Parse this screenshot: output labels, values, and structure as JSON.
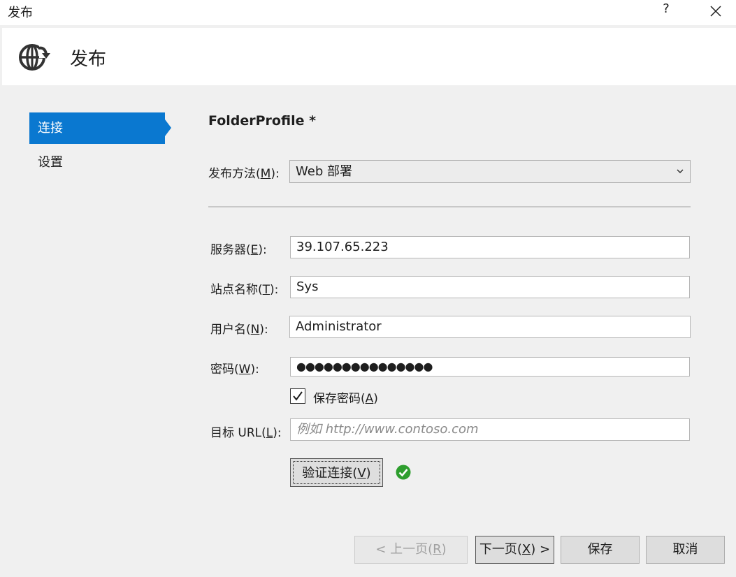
{
  "window": {
    "title": "发布",
    "help_label": "?"
  },
  "header": {
    "heading": "发布"
  },
  "sidebar": {
    "items": [
      {
        "label": "连接",
        "selected": true
      },
      {
        "label": "设置",
        "selected": false
      }
    ],
    "accent": "#0a78d0"
  },
  "content": {
    "profile_title": "FolderProfile *",
    "publish_method": {
      "label": "发布方法(",
      "mnemonic": "M",
      "label_end": "):",
      "value": "Web 部署"
    },
    "server": {
      "label": "服务器(",
      "mnemonic": "E",
      "label_end": "):",
      "value": "39.107.65.223"
    },
    "site_name": {
      "label": "站点名称(",
      "mnemonic": "T",
      "label_end": "):",
      "value": "Sys"
    },
    "username": {
      "label": "用户名(",
      "mnemonic": "N",
      "label_end": "):",
      "value": "Administrator"
    },
    "password": {
      "label": "密码(",
      "mnemonic": "W",
      "label_end": "):",
      "value": "●●●●●●●●●●●●●●●"
    },
    "save_password": {
      "label": "保存密码(",
      "mnemonic": "A",
      "label_end": ")",
      "checked": true
    },
    "target_url": {
      "label": "目标 URL(",
      "mnemonic": "L",
      "label_end": "):",
      "value": "",
      "placeholder": "例如 http://www.contoso.com"
    },
    "validate": {
      "label": "验证连接(",
      "mnemonic": "V",
      "label_end": ")",
      "status": "success",
      "status_color": "#2e9e2e"
    }
  },
  "footer": {
    "prev_label": "< 上一页(",
    "prev_mnemonic": "R",
    "prev_end": ")",
    "next_label": "下一页(",
    "next_mnemonic": "X",
    "next_end": ") >",
    "save_label": "保存",
    "cancel_label": "取消"
  }
}
